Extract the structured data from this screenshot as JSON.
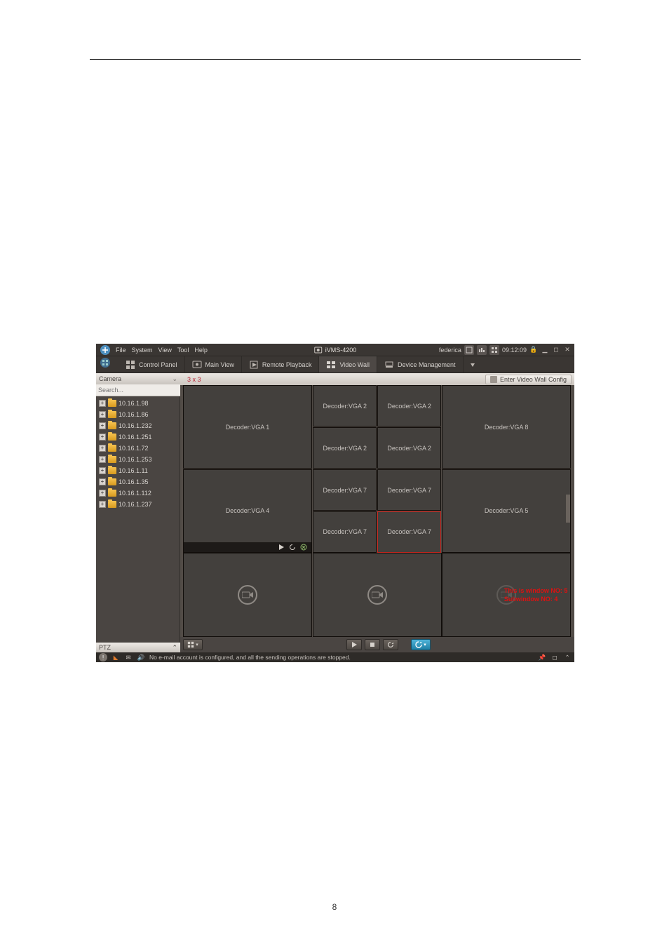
{
  "doc": {
    "page_number": "8"
  },
  "app": {
    "menu": [
      "File",
      "System",
      "View",
      "Tool",
      "Help"
    ],
    "title": "iVMS-4200",
    "user": "federica",
    "clock": "09:12:09",
    "tabs": [
      {
        "id": "control-panel",
        "label": "Control Panel"
      },
      {
        "id": "main-view",
        "label": "Main View"
      },
      {
        "id": "remote-playback",
        "label": "Remote Playback"
      },
      {
        "id": "video-wall",
        "label": "Video Wall"
      },
      {
        "id": "device-management",
        "label": "Device Management"
      }
    ],
    "active_tab": "video-wall"
  },
  "left": {
    "header": "Camera",
    "search_placeholder": "Search...",
    "ptz": "PTZ",
    "items": [
      "10.16.1.98",
      "10.16.1.86",
      "10.16.1.232",
      "10.16.1.251",
      "10.16.1.72",
      "10.16.1.253",
      "10.16.1.11",
      "10.16.1.35",
      "10.16.1.112",
      "10.16.1.237"
    ]
  },
  "main": {
    "layout_label": "3 x 3",
    "config_button": "Enter Video Wall Config",
    "cells": {
      "r0c0": "Decoder:VGA 1",
      "r0c1a": "Decoder:VGA 2",
      "r0c1b": "Decoder:VGA 2",
      "r0c1c": "Decoder:VGA 2",
      "r0c1d": "Decoder:VGA 2",
      "r0c2": "Decoder:VGA 8",
      "r1c0": "Decoder:VGA 4",
      "r1c1a": "Decoder:VGA 7",
      "r1c1b": "Decoder:VGA 7",
      "r1c1c": "Decoder:VGA 7",
      "r1c1d": "Decoder:VGA 7",
      "r1c2": "Decoder:VGA 5"
    },
    "highlight": {
      "line1": "This is window NO: 5",
      "line2": "Subwindow NO: 4"
    }
  },
  "status": {
    "message": "No e-mail account is configured, and all the sending operations are stopped."
  }
}
